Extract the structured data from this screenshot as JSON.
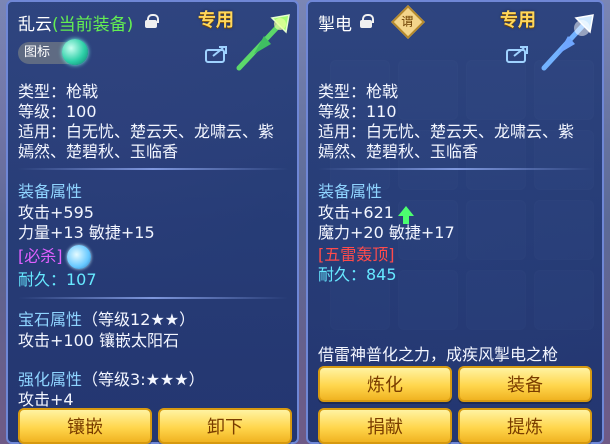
{
  "colors": {
    "panel_border": "#6f87d6",
    "button_text": "#7a3d00",
    "exclusive": "#ffd75a"
  },
  "left": {
    "title": "乱云",
    "title_suffix": "(当前装备)",
    "exclusive_label": "专用",
    "badge_label": "图标",
    "type": "类型：枪戟",
    "level": "等级：100",
    "applies_line1": "适用：白无忧、楚云天、龙啸云、紫",
    "applies_line2": "嫣然、楚碧秋、玉临香",
    "attr_header": "装备属性",
    "attack": "攻击+595",
    "stats": "力量+13  敏捷+15",
    "special_label": "[必杀]",
    "durability": "耐久：107",
    "gem_header": "宝石属性",
    "gem_level": "（等级12★★）",
    "gem_stats": "攻击+100 镶嵌太阳石",
    "enhance_header": "强化属性",
    "enhance_level": "（等级3:★★★）",
    "enhance_stats": "攻击+4",
    "buttons": {
      "inlay": "镶嵌",
      "unequip": "卸下"
    }
  },
  "right": {
    "title": "掣电",
    "exclusive_label": "专用",
    "special_char": "谓",
    "type": "类型：枪戟",
    "level": "等级：110",
    "applies_line1": "适用：白无忧、楚云天、龙啸云、紫",
    "applies_line2": "嫣然、楚碧秋、玉临香",
    "attr_header": "装备属性",
    "attack": "攻击+621",
    "stats": "魔力+20  敏捷+17",
    "special_label": "[五雷轰顶]",
    "durability": "耐久：845",
    "desc": "借雷神普化之力，成疾风掣电之枪",
    "buttons": {
      "refine": "炼化",
      "equip": "装备",
      "donate": "捐献",
      "extract": "提炼"
    }
  }
}
